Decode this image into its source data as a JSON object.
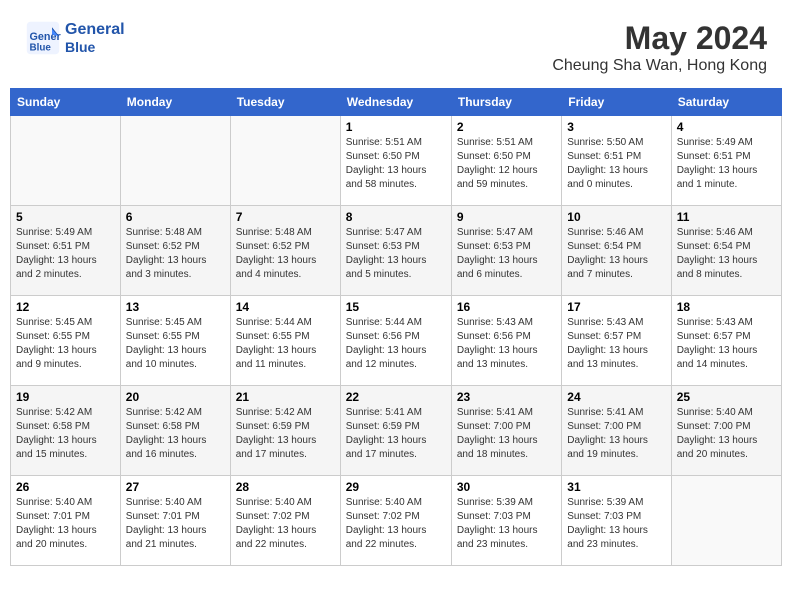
{
  "header": {
    "logo_line1": "General",
    "logo_line2": "Blue",
    "month_title": "May 2024",
    "location": "Cheung Sha Wan, Hong Kong"
  },
  "days_of_week": [
    "Sunday",
    "Monday",
    "Tuesday",
    "Wednesday",
    "Thursday",
    "Friday",
    "Saturday"
  ],
  "weeks": [
    {
      "days": [
        {
          "num": "",
          "info": ""
        },
        {
          "num": "",
          "info": ""
        },
        {
          "num": "",
          "info": ""
        },
        {
          "num": "1",
          "info": "Sunrise: 5:51 AM\nSunset: 6:50 PM\nDaylight: 13 hours\nand 58 minutes."
        },
        {
          "num": "2",
          "info": "Sunrise: 5:51 AM\nSunset: 6:50 PM\nDaylight: 12 hours\nand 59 minutes."
        },
        {
          "num": "3",
          "info": "Sunrise: 5:50 AM\nSunset: 6:51 PM\nDaylight: 13 hours\nand 0 minutes."
        },
        {
          "num": "4",
          "info": "Sunrise: 5:49 AM\nSunset: 6:51 PM\nDaylight: 13 hours\nand 1 minute."
        }
      ]
    },
    {
      "days": [
        {
          "num": "5",
          "info": "Sunrise: 5:49 AM\nSunset: 6:51 PM\nDaylight: 13 hours\nand 2 minutes."
        },
        {
          "num": "6",
          "info": "Sunrise: 5:48 AM\nSunset: 6:52 PM\nDaylight: 13 hours\nand 3 minutes."
        },
        {
          "num": "7",
          "info": "Sunrise: 5:48 AM\nSunset: 6:52 PM\nDaylight: 13 hours\nand 4 minutes."
        },
        {
          "num": "8",
          "info": "Sunrise: 5:47 AM\nSunset: 6:53 PM\nDaylight: 13 hours\nand 5 minutes."
        },
        {
          "num": "9",
          "info": "Sunrise: 5:47 AM\nSunset: 6:53 PM\nDaylight: 13 hours\nand 6 minutes."
        },
        {
          "num": "10",
          "info": "Sunrise: 5:46 AM\nSunset: 6:54 PM\nDaylight: 13 hours\nand 7 minutes."
        },
        {
          "num": "11",
          "info": "Sunrise: 5:46 AM\nSunset: 6:54 PM\nDaylight: 13 hours\nand 8 minutes."
        }
      ]
    },
    {
      "days": [
        {
          "num": "12",
          "info": "Sunrise: 5:45 AM\nSunset: 6:55 PM\nDaylight: 13 hours\nand 9 minutes."
        },
        {
          "num": "13",
          "info": "Sunrise: 5:45 AM\nSunset: 6:55 PM\nDaylight: 13 hours\nand 10 minutes."
        },
        {
          "num": "14",
          "info": "Sunrise: 5:44 AM\nSunset: 6:55 PM\nDaylight: 13 hours\nand 11 minutes."
        },
        {
          "num": "15",
          "info": "Sunrise: 5:44 AM\nSunset: 6:56 PM\nDaylight: 13 hours\nand 12 minutes."
        },
        {
          "num": "16",
          "info": "Sunrise: 5:43 AM\nSunset: 6:56 PM\nDaylight: 13 hours\nand 13 minutes."
        },
        {
          "num": "17",
          "info": "Sunrise: 5:43 AM\nSunset: 6:57 PM\nDaylight: 13 hours\nand 13 minutes."
        },
        {
          "num": "18",
          "info": "Sunrise: 5:43 AM\nSunset: 6:57 PM\nDaylight: 13 hours\nand 14 minutes."
        }
      ]
    },
    {
      "days": [
        {
          "num": "19",
          "info": "Sunrise: 5:42 AM\nSunset: 6:58 PM\nDaylight: 13 hours\nand 15 minutes."
        },
        {
          "num": "20",
          "info": "Sunrise: 5:42 AM\nSunset: 6:58 PM\nDaylight: 13 hours\nand 16 minutes."
        },
        {
          "num": "21",
          "info": "Sunrise: 5:42 AM\nSunset: 6:59 PM\nDaylight: 13 hours\nand 17 minutes."
        },
        {
          "num": "22",
          "info": "Sunrise: 5:41 AM\nSunset: 6:59 PM\nDaylight: 13 hours\nand 17 minutes."
        },
        {
          "num": "23",
          "info": "Sunrise: 5:41 AM\nSunset: 7:00 PM\nDaylight: 13 hours\nand 18 minutes."
        },
        {
          "num": "24",
          "info": "Sunrise: 5:41 AM\nSunset: 7:00 PM\nDaylight: 13 hours\nand 19 minutes."
        },
        {
          "num": "25",
          "info": "Sunrise: 5:40 AM\nSunset: 7:00 PM\nDaylight: 13 hours\nand 20 minutes."
        }
      ]
    },
    {
      "days": [
        {
          "num": "26",
          "info": "Sunrise: 5:40 AM\nSunset: 7:01 PM\nDaylight: 13 hours\nand 20 minutes."
        },
        {
          "num": "27",
          "info": "Sunrise: 5:40 AM\nSunset: 7:01 PM\nDaylight: 13 hours\nand 21 minutes."
        },
        {
          "num": "28",
          "info": "Sunrise: 5:40 AM\nSunset: 7:02 PM\nDaylight: 13 hours\nand 22 minutes."
        },
        {
          "num": "29",
          "info": "Sunrise: 5:40 AM\nSunset: 7:02 PM\nDaylight: 13 hours\nand 22 minutes."
        },
        {
          "num": "30",
          "info": "Sunrise: 5:39 AM\nSunset: 7:03 PM\nDaylight: 13 hours\nand 23 minutes."
        },
        {
          "num": "31",
          "info": "Sunrise: 5:39 AM\nSunset: 7:03 PM\nDaylight: 13 hours\nand 23 minutes."
        },
        {
          "num": "",
          "info": ""
        }
      ]
    }
  ]
}
